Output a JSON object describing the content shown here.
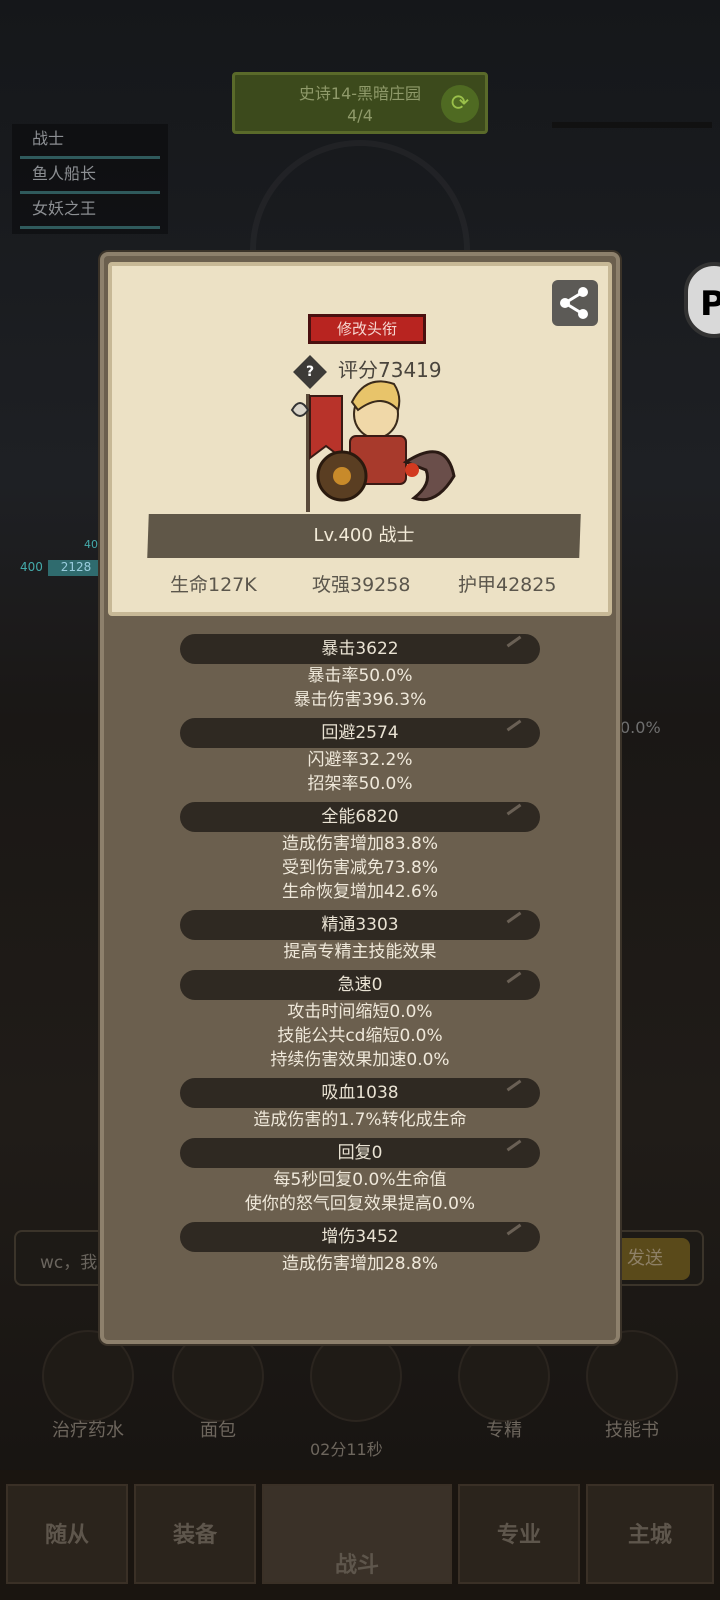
{
  "background": {
    "stage": {
      "name": "史诗14-黑暗庄园",
      "progress": "4/4"
    },
    "team": [
      "战士",
      "鱼人船长",
      "女妖之王"
    ],
    "left_hp": {
      "level_a": "400",
      "level_b": "400",
      "bar_text": "2128"
    },
    "right_percent": "0.0%",
    "chat": {
      "input_text": "wc，我",
      "send_label": "发送"
    },
    "abilities": [
      {
        "label": "治疗药水",
        "icon": "potion-icon"
      },
      {
        "label": "面包",
        "icon": "bread-icon"
      },
      {
        "label": "",
        "icon": "chest-icon"
      },
      {
        "label": "专精",
        "icon": "specialty-icon"
      },
      {
        "label": "技能书",
        "icon": "skillbook-icon"
      }
    ],
    "timer": "02分11秒",
    "nav": [
      "随从",
      "装备",
      "战斗",
      "专业",
      "主城"
    ]
  },
  "panel": {
    "edit_title_label": "修改头衔",
    "score": "评分73419",
    "level": "Lv.400 战士",
    "base_stats": {
      "hp": "生命127K",
      "attack": "攻强39258",
      "armor": "护甲42825"
    },
    "stat_groups": [
      {
        "header": "暴击3622",
        "lines": [
          "暴击率50.0%",
          "暴击伤害396.3%"
        ]
      },
      {
        "header": "回避2574",
        "lines": [
          "闪避率32.2%",
          "招架率50.0%"
        ]
      },
      {
        "header": "全能6820",
        "lines": [
          "造成伤害增加83.8%",
          "受到伤害减免73.8%",
          "生命恢复增加42.6%"
        ]
      },
      {
        "header": "精通3303",
        "lines": [
          "提高专精主技能效果"
        ]
      },
      {
        "header": "急速0",
        "lines": [
          "攻击时间缩短0.0%",
          "技能公共cd缩短0.0%",
          "持续伤害效果加速0.0%"
        ]
      },
      {
        "header": "吸血1038",
        "lines": [
          "造成伤害的1.7%转化成生命"
        ]
      },
      {
        "header": "回复0",
        "lines": [
          "每5秒回复0.0%生命值",
          "使你的怒气回复效果提高0.0%"
        ]
      },
      {
        "header": "增伤3452",
        "lines": [
          "造成伤害增加28.8%"
        ]
      }
    ]
  },
  "colors": {
    "panel_bg": "#6b5f4e",
    "card_bg": "#ece1c5",
    "header_bg": "#2f2922",
    "edit_btn": "#b82420"
  }
}
